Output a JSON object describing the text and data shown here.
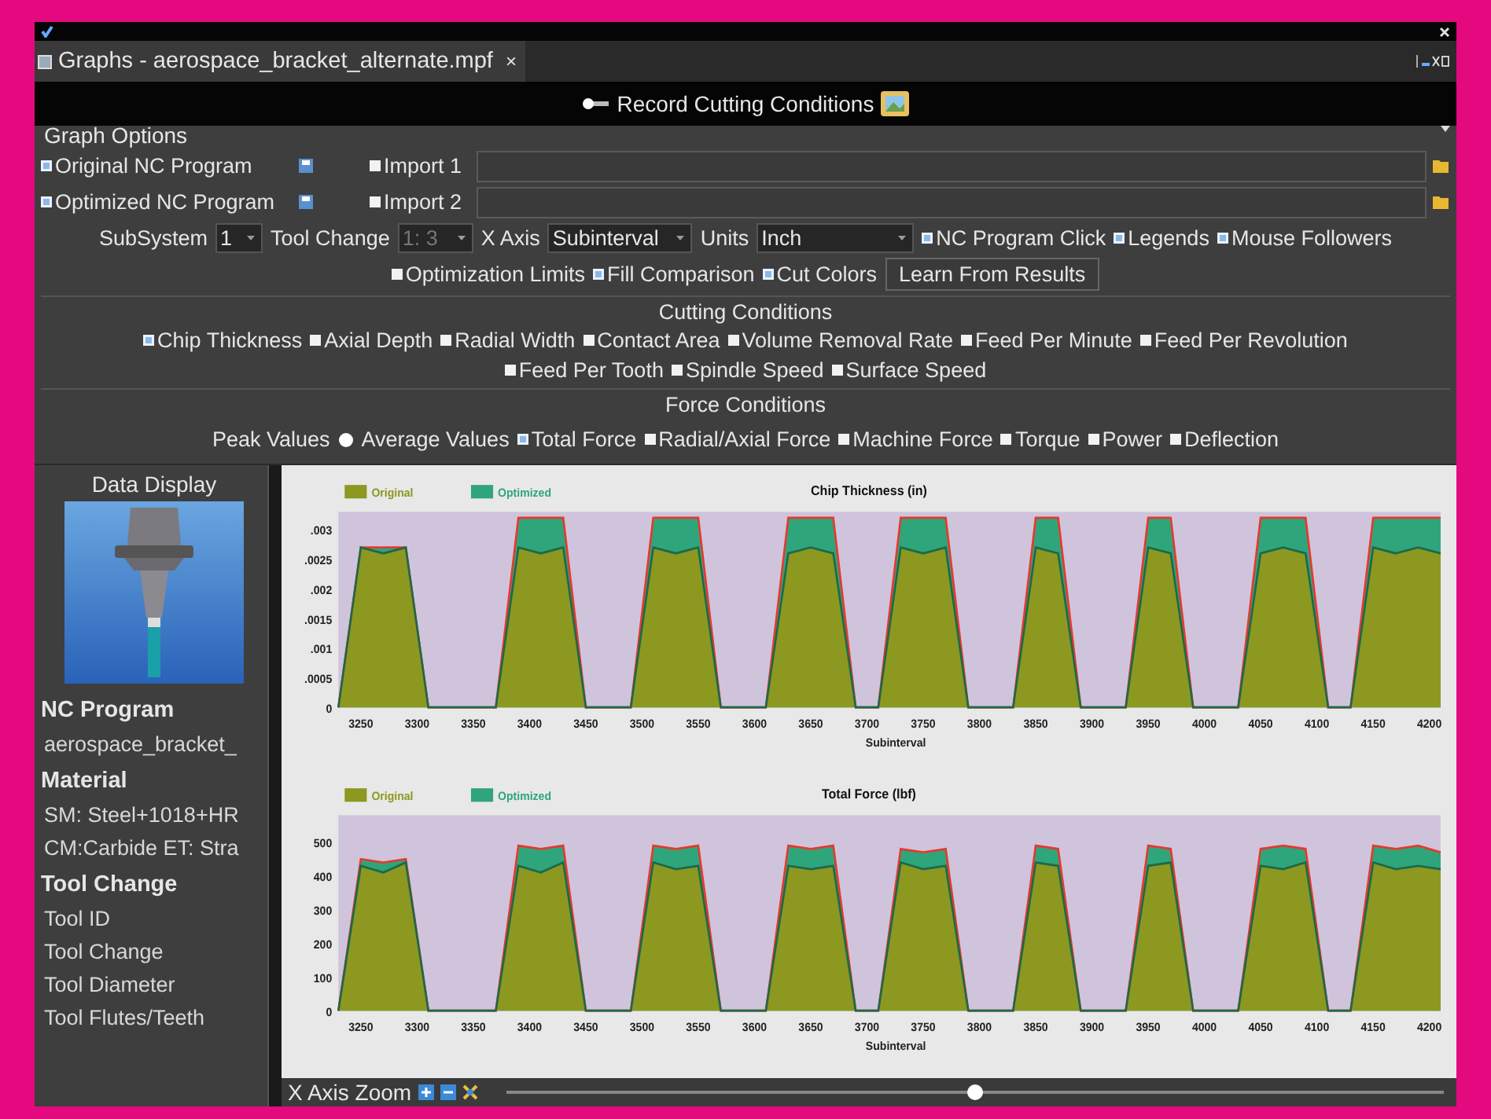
{
  "tab": {
    "title": "Graphs - aerospace_bracket_alternate.mpf",
    "close": "×"
  },
  "record": {
    "label": "Record Cutting Conditions"
  },
  "graph_options": {
    "title": "Graph Options",
    "programs": [
      {
        "label": "Original NC Program",
        "checked": true,
        "import_label": "Import 1",
        "import_checked": false
      },
      {
        "label": "Optimized NC Program",
        "checked": true,
        "import_label": "Import 2",
        "import_checked": false
      }
    ],
    "selectors": [
      {
        "label": "SubSystem",
        "value": "1",
        "disabled": false
      },
      {
        "label": "Tool Change",
        "value": "1: 3",
        "disabled": true
      },
      {
        "label": "X Axis",
        "value": "Subinterval",
        "disabled": false
      },
      {
        "label": "Units",
        "value": "Inch",
        "disabled": false
      }
    ],
    "toggles": [
      {
        "label": "NC Program Click",
        "checked": true
      },
      {
        "label": "Legends",
        "checked": true
      },
      {
        "label": "Mouse Followers",
        "checked": true
      }
    ],
    "options": [
      {
        "label": "Optimization Limits",
        "checked": false
      },
      {
        "label": "Fill Comparison",
        "checked": true
      },
      {
        "label": "Cut Colors",
        "checked": true
      }
    ],
    "learn_button": "Learn From Results"
  },
  "cutting_conditions": {
    "title": "Cutting Conditions",
    "options": [
      {
        "label": "Chip Thickness",
        "checked": true
      },
      {
        "label": "Axial Depth",
        "checked": false
      },
      {
        "label": "Radial Width",
        "checked": false
      },
      {
        "label": "Contact Area",
        "checked": false
      },
      {
        "label": "Volume Removal Rate",
        "checked": false
      },
      {
        "label": "Feed Per Minute",
        "checked": false
      },
      {
        "label": "Feed Per Revolution",
        "checked": false
      },
      {
        "label": "Feed Per Tooth",
        "checked": false
      },
      {
        "label": "Spindle Speed",
        "checked": false
      },
      {
        "label": "Surface Speed",
        "checked": false
      }
    ]
  },
  "force_conditions": {
    "title": "Force Conditions",
    "peak_label": "Peak Values",
    "average_label": "Average Values",
    "options": [
      {
        "label": "Total Force",
        "checked": true
      },
      {
        "label": "Radial/Axial Force",
        "checked": false
      },
      {
        "label": "Machine Force",
        "checked": false
      },
      {
        "label": "Torque",
        "checked": false
      },
      {
        "label": "Power",
        "checked": false
      },
      {
        "label": "Deflection",
        "checked": false
      }
    ]
  },
  "data_display": {
    "title": "Data Display",
    "sections": [
      {
        "heading": "NC Program",
        "items": [
          "aerospace_bracket_"
        ]
      },
      {
        "heading": "Material",
        "items": [
          "SM: Steel+1018+HR",
          "CM:Carbide ET: Stra"
        ]
      },
      {
        "heading": "Tool Change",
        "items": [
          "Tool ID",
          "Tool Change",
          "Tool Diameter",
          "Tool Flutes/Teeth"
        ]
      }
    ]
  },
  "charts": [
    {
      "chart_data": {
        "type": "area",
        "legend": "top-left",
        "title": "Chip Thickness (in)",
        "xlabel": "Subinterval",
        "xlim": [
          3230,
          4210
        ],
        "ylim": [
          0,
          0.0033
        ],
        "xticks": [
          3250,
          3300,
          3350,
          3400,
          3450,
          3500,
          3550,
          3600,
          3650,
          3700,
          3750,
          3800,
          3850,
          3900,
          3950,
          4000,
          4050,
          4100,
          4150,
          4200
        ],
        "yticks": [
          {
            "value": 0,
            "label": "0"
          },
          {
            "value": 0.0005,
            "label": ".0005"
          },
          {
            "value": 0.001,
            "label": ".001"
          },
          {
            "value": 0.0015,
            "label": ".0015"
          },
          {
            "value": 0.002,
            "label": ".002"
          },
          {
            "value": 0.0025,
            "label": ".0025"
          },
          {
            "value": 0.003,
            "label": ".003"
          }
        ],
        "x": [
          3230,
          3250,
          3270,
          3290,
          3310,
          3330,
          3350,
          3370,
          3390,
          3410,
          3430,
          3450,
          3470,
          3490,
          3510,
          3530,
          3550,
          3570,
          3590,
          3610,
          3630,
          3650,
          3670,
          3690,
          3710,
          3730,
          3750,
          3770,
          3790,
          3810,
          3830,
          3850,
          3870,
          3890,
          3910,
          3930,
          3950,
          3970,
          3990,
          4010,
          4030,
          4050,
          4070,
          4090,
          4110,
          4130,
          4150,
          4170,
          4190,
          4210
        ],
        "series": [
          {
            "name": "Optimized",
            "color": "#2fa57c",
            "values": [
              0,
              0.0027,
              0.0027,
              0.0027,
              0,
              0,
              0,
              0,
              0.0032,
              0.0032,
              0.0032,
              0,
              0,
              0,
              0.0032,
              0.0032,
              0.0032,
              0,
              0,
              0,
              0.0032,
              0.0032,
              0.0032,
              0,
              0,
              0.0032,
              0.0032,
              0.0032,
              0,
              0,
              0,
              0.0032,
              0.0032,
              0,
              0,
              0,
              0.0032,
              0.0032,
              0,
              0,
              0,
              0.0032,
              0.0032,
              0.0032,
              0,
              0,
              0.0032,
              0.0032,
              0.0032,
              0.0032
            ]
          },
          {
            "name": "Original",
            "color": "#8c9820",
            "values": [
              0,
              0.0027,
              0.0026,
              0.0027,
              0,
              0,
              0,
              0,
              0.0027,
              0.0026,
              0.0027,
              0,
              0,
              0,
              0.0027,
              0.0026,
              0.0027,
              0,
              0,
              0,
              0.0026,
              0.0027,
              0.0026,
              0,
              0,
              0.0027,
              0.0026,
              0.0027,
              0,
              0,
              0,
              0.0027,
              0.0026,
              0,
              0,
              0,
              0.0027,
              0.0026,
              0,
              0,
              0,
              0.0026,
              0.0027,
              0.0026,
              0,
              0,
              0.0027,
              0.0026,
              0.0027,
              0.0026
            ]
          }
        ]
      }
    },
    {
      "chart_data": {
        "type": "area",
        "legend": "top-left",
        "title": "Total Force (lbf)",
        "xlabel": "Subinterval",
        "xlim": [
          3230,
          4210
        ],
        "ylim": [
          0,
          580
        ],
        "xticks": [
          3250,
          3300,
          3350,
          3400,
          3450,
          3500,
          3550,
          3600,
          3650,
          3700,
          3750,
          3800,
          3850,
          3900,
          3950,
          4000,
          4050,
          4100,
          4150,
          4200
        ],
        "yticks": [
          0,
          100,
          200,
          300,
          400,
          500
        ],
        "x": [
          3230,
          3250,
          3270,
          3290,
          3310,
          3330,
          3350,
          3370,
          3390,
          3410,
          3430,
          3450,
          3470,
          3490,
          3510,
          3530,
          3550,
          3570,
          3590,
          3610,
          3630,
          3650,
          3670,
          3690,
          3710,
          3730,
          3750,
          3770,
          3790,
          3810,
          3830,
          3850,
          3870,
          3890,
          3910,
          3930,
          3950,
          3970,
          3990,
          4010,
          4030,
          4050,
          4070,
          4090,
          4110,
          4130,
          4150,
          4170,
          4190,
          4210
        ],
        "series": [
          {
            "name": "Optimized",
            "color": "#2fa57c",
            "values": [
              0,
              450,
              440,
              450,
              0,
              0,
              0,
              0,
              490,
              480,
              490,
              0,
              0,
              0,
              490,
              480,
              490,
              0,
              0,
              0,
              490,
              480,
              490,
              0,
              0,
              480,
              470,
              480,
              0,
              0,
              0,
              490,
              480,
              0,
              0,
              0,
              490,
              480,
              0,
              0,
              0,
              480,
              490,
              480,
              0,
              0,
              490,
              480,
              490,
              470
            ]
          },
          {
            "name": "Original",
            "color": "#8c9820",
            "values": [
              0,
              430,
              410,
              440,
              0,
              0,
              0,
              0,
              430,
              410,
              440,
              0,
              0,
              0,
              440,
              420,
              430,
              0,
              0,
              0,
              430,
              420,
              430,
              0,
              0,
              440,
              420,
              430,
              0,
              0,
              0,
              440,
              430,
              0,
              0,
              0,
              430,
              440,
              0,
              0,
              0,
              430,
              420,
              440,
              0,
              0,
              440,
              420,
              430,
              420
            ]
          }
        ]
      }
    }
  ],
  "zoom": {
    "label": "X Axis Zoom",
    "level": 0.5
  }
}
